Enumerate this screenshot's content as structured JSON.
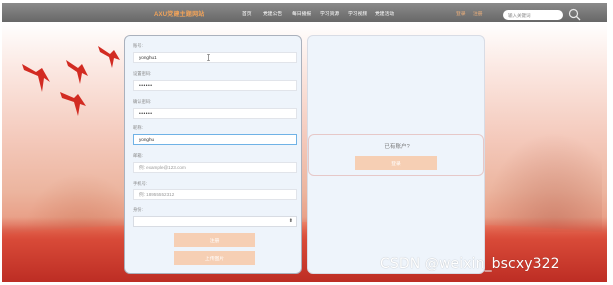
{
  "header": {
    "brand": "AXU党建主题网站",
    "nav": [
      "首页",
      "党建公告",
      "每日播报",
      "学习资源",
      "学习视频",
      "党建活动"
    ],
    "login": "登录",
    "register": "注册",
    "search_placeholder": "输入关键词"
  },
  "form": {
    "fields": [
      {
        "label": "账号:",
        "value": "yonghu1",
        "placeholder": "",
        "type": "text"
      },
      {
        "label": "设置密码:",
        "value": "••••••",
        "placeholder": "",
        "type": "password"
      },
      {
        "label": "确认密码:",
        "value": "••••••",
        "placeholder": "",
        "type": "password"
      },
      {
        "label": "昵称:",
        "value": "yonghu",
        "placeholder": "",
        "type": "text"
      },
      {
        "label": "邮箱:",
        "value": "",
        "placeholder": "例: example@123.com",
        "type": "text"
      },
      {
        "label": "手机号:",
        "value": "",
        "placeholder": "例: 18955552312",
        "type": "text"
      }
    ],
    "role_label": "身份:",
    "role_value": "",
    "submit_label": "注册",
    "upload_label": "上传图片"
  },
  "side": {
    "prompt": "已有账户?",
    "login_label": "登录"
  },
  "watermark": "CSDN @weixin_bscxy322",
  "colors": {
    "nav_bg": "#787878",
    "brand": "#f1a35a",
    "accent_peach": "#f6cfb4",
    "panel_bg": "#eef4fb",
    "scene_red": "#c4332a"
  }
}
